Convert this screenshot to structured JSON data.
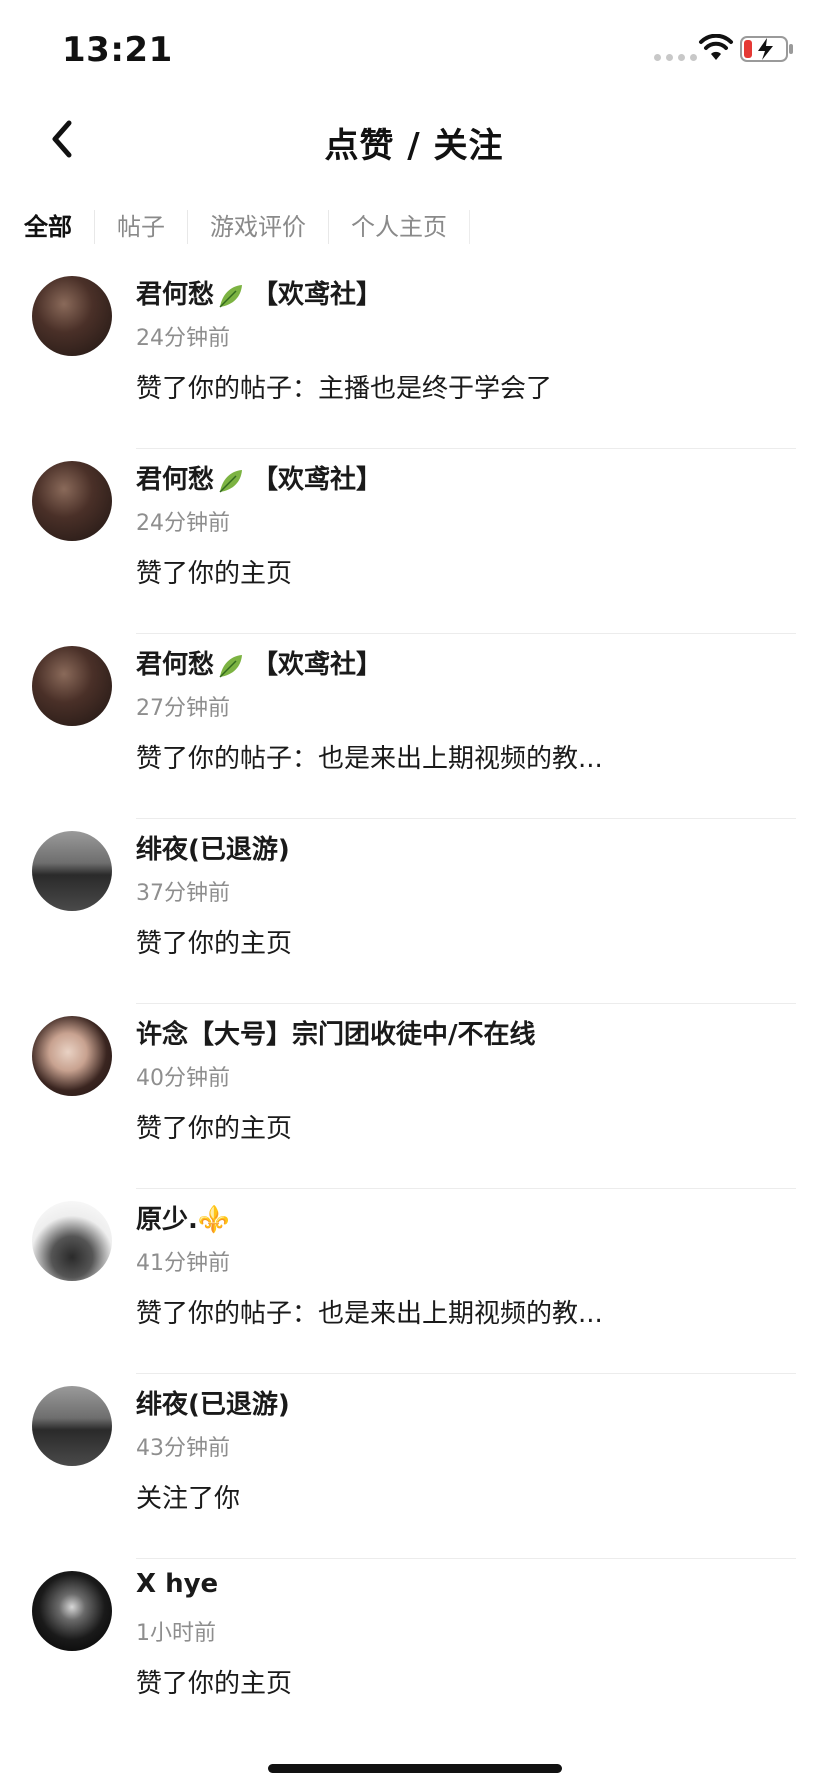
{
  "status_bar": {
    "time": "13:21"
  },
  "header": {
    "title": "点赞 / 关注"
  },
  "tabs": [
    {
      "label": "全部",
      "active": true
    },
    {
      "label": "帖子",
      "active": false
    },
    {
      "label": "游戏评价",
      "active": false
    },
    {
      "label": "个人主页",
      "active": false
    }
  ],
  "notifications": [
    {
      "name": "君何愁",
      "suffix": "【欢鸢社】",
      "time": "24分钟前",
      "action": "赞了你的帖子：主播也是终于学会了",
      "avatar": "dark-art",
      "badge_icon": "leaf-icon"
    },
    {
      "name": "君何愁",
      "suffix": "【欢鸢社】",
      "time": "24分钟前",
      "action": "赞了你的主页",
      "avatar": "dark-art",
      "badge_icon": "leaf-icon"
    },
    {
      "name": "君何愁",
      "suffix": "【欢鸢社】",
      "time": "27分钟前",
      "action": "赞了你的帖子：也是来出上期视频的教...",
      "avatar": "dark-art",
      "badge_icon": "leaf-icon"
    },
    {
      "name": "绯夜(已退游)",
      "suffix": "",
      "time": "37分钟前",
      "action": "赞了你的主页",
      "avatar": "sea-silhouette"
    },
    {
      "name": "许念【大号】宗门团收徒中/不在线",
      "suffix": "",
      "time": "40分钟前",
      "action": "赞了你的主页",
      "avatar": "girl-portrait"
    },
    {
      "name": "原少.",
      "suffix": "⚜️",
      "time": "41分钟前",
      "action": "赞了你的帖子：也是来出上期视频的教...",
      "avatar": "sketch",
      "badge_icon": "fleur-de-lis-icon"
    },
    {
      "name": "绯夜(已退游)",
      "suffix": "",
      "time": "43分钟前",
      "action": "关注了你",
      "avatar": "sea-silhouette"
    },
    {
      "name": "X hye",
      "suffix": "",
      "time": "1小时前",
      "action": "赞了你的主页",
      "avatar": "goth-portrait"
    }
  ],
  "colors": {
    "primary_text": "#1a1a1a",
    "secondary_text": "#8e8e8e",
    "divider": "#ececec",
    "battery_low": "#e53935"
  }
}
